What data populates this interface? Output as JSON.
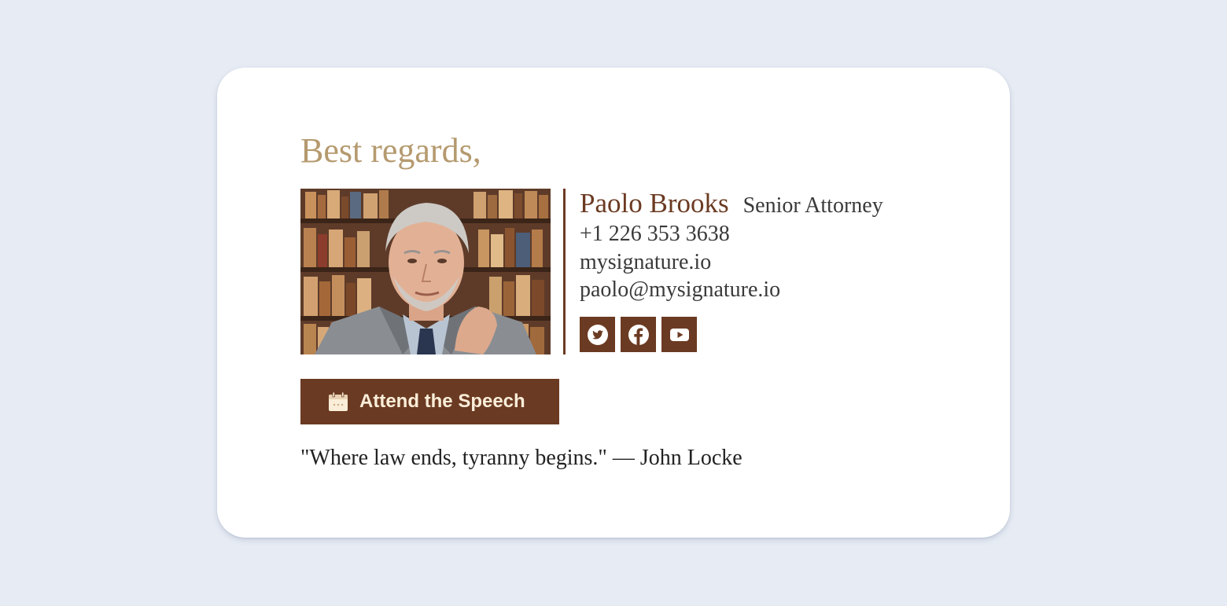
{
  "signature": {
    "greeting": "Best regards,",
    "name": "Paolo Brooks",
    "title": "Senior Attorney",
    "phone": "+1 226 353 3638",
    "website": "mysignature.io",
    "email": "paolo@mysignature.io",
    "photo_icon": "portrait-photo",
    "socials": [
      {
        "icon": "twitter-icon"
      },
      {
        "icon": "facebook-icon"
      },
      {
        "icon": "youtube-icon"
      }
    ],
    "cta": {
      "icon": "calendar-icon",
      "label": "Attend the Speech"
    },
    "quote": "\"Where law ends, tyranny begins.\" — John Locke"
  },
  "colors": {
    "background": "#e7ecf4",
    "card": "#ffffff",
    "accent_brown": "#6b3a22",
    "greeting_gold": "#b59a6f",
    "text_dark": "#3a3a3a",
    "button_text": "#fbeed9"
  }
}
